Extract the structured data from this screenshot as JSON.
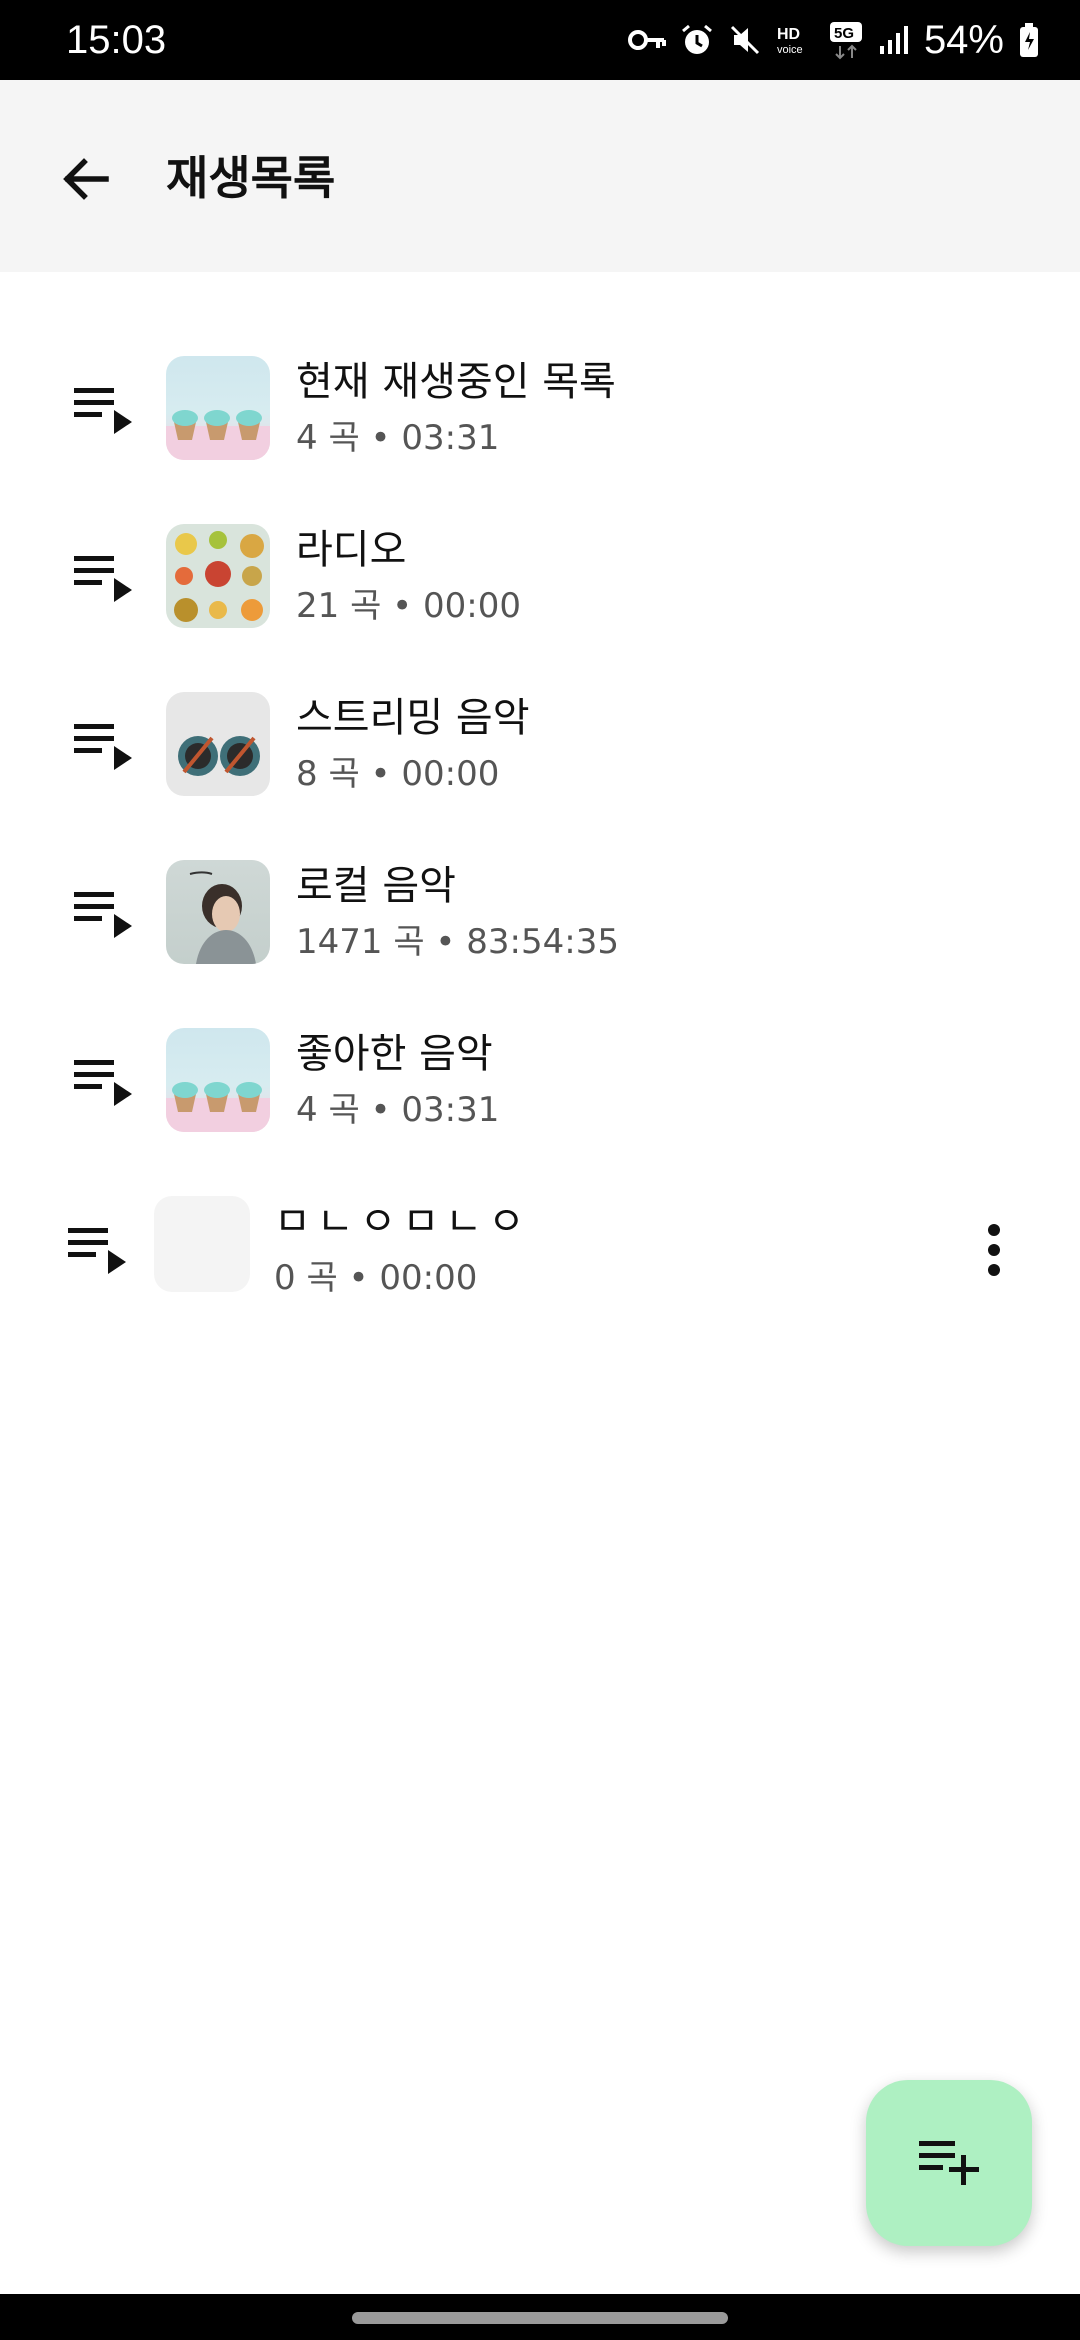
{
  "status_bar": {
    "time": "15:03",
    "battery": "54%",
    "icons": [
      "vpn-key-icon",
      "alarm-icon",
      "mute-icon",
      "hd-voice-icon",
      "5g-icon",
      "signal-icon",
      "battery-icon"
    ]
  },
  "app_bar": {
    "title": "재생목록",
    "back_icon": "arrow-back-icon"
  },
  "playlists": [
    {
      "title": "현재 재생중인 목록",
      "meta": "4 곡 • 03:31"
    },
    {
      "title": "라디오",
      "meta": "21 곡 • 00:00"
    },
    {
      "title": "스트리밍 음악",
      "meta": "8 곡 • 00:00"
    },
    {
      "title": "로컬 음악",
      "meta": "1471 곡 • 83:54:35"
    },
    {
      "title": "좋아한 음악",
      "meta": "4 곡 • 03:31"
    },
    {
      "title": "ㅁㄴㅇㅁㄴㅇ",
      "meta": "0 곡 • 00:00"
    }
  ],
  "fab": {
    "icon": "playlist-add-icon",
    "color": "#aef0c2"
  }
}
